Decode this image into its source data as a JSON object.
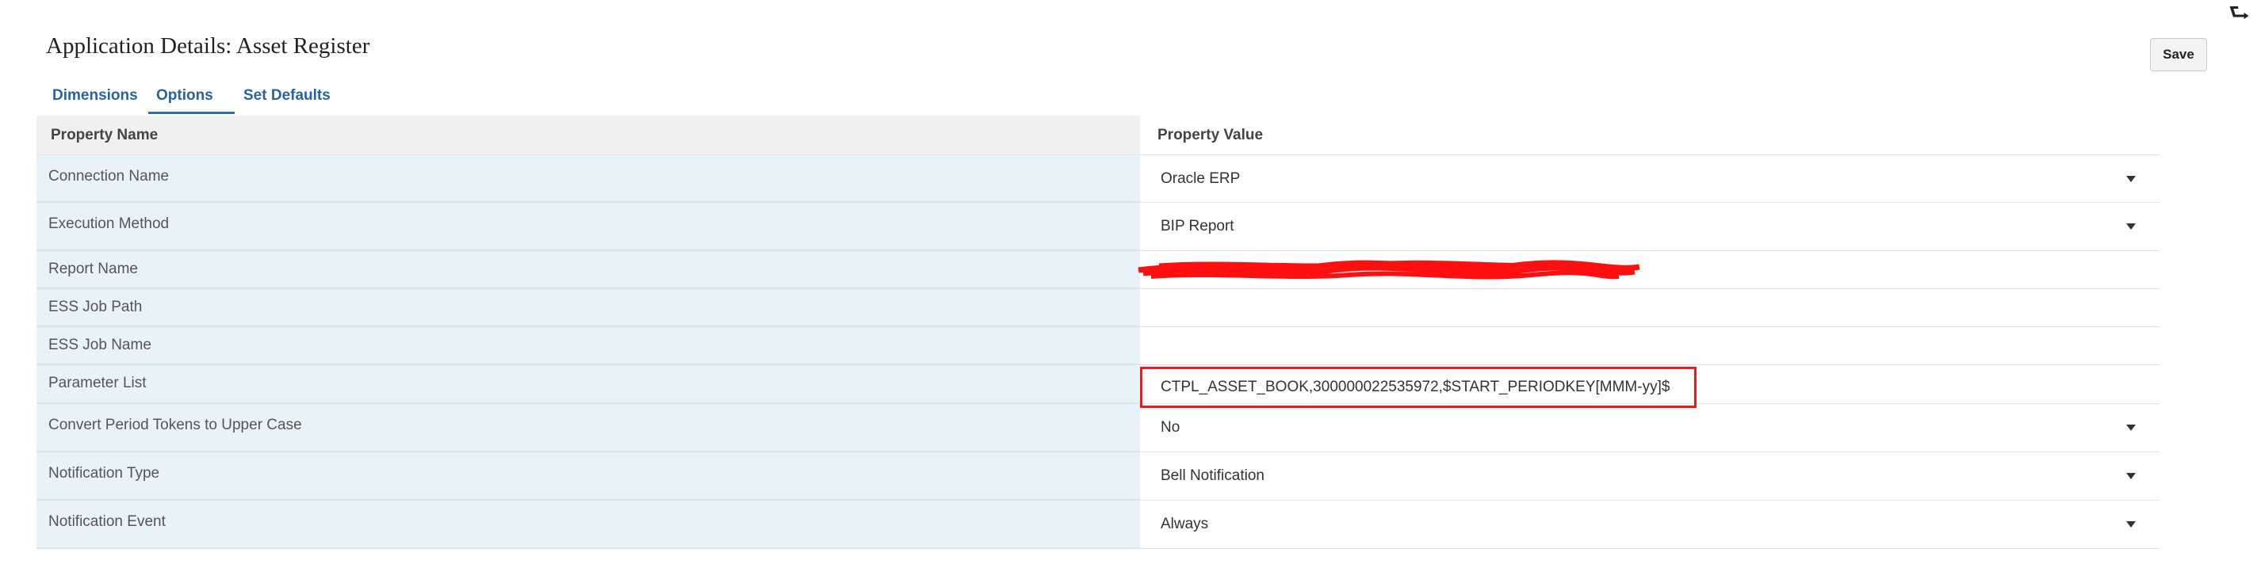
{
  "page": {
    "title": "Application Details: Asset Register",
    "corner_icon": "upload-arrow-icon"
  },
  "toolbar": {
    "save_label": "Save"
  },
  "tabs": [
    {
      "label": "Dimensions",
      "active": false
    },
    {
      "label": "Options",
      "active": true
    },
    {
      "label": "Set Defaults",
      "active": false
    }
  ],
  "table": {
    "headers": {
      "name": "Property Name",
      "value": "Property Value"
    },
    "rows": [
      {
        "name": "Connection Name",
        "value": "Oracle ERP",
        "type": "dropdown"
      },
      {
        "name": "Execution Method",
        "value": "BIP Report",
        "type": "dropdown"
      },
      {
        "name": "Report Name",
        "value": "",
        "type": "redacted"
      },
      {
        "name": "ESS Job Path",
        "value": "",
        "type": "text"
      },
      {
        "name": "ESS Job Name",
        "value": "",
        "type": "text"
      },
      {
        "name": "Parameter List",
        "value": "CTPL_ASSET_BOOK,300000022535972,$START_PERIODKEY[MMM-yy]$",
        "type": "highlighted"
      },
      {
        "name": "Convert Period Tokens to Upper Case",
        "value": "No",
        "type": "dropdown"
      },
      {
        "name": "Notification Type",
        "value": "Bell Notification",
        "type": "dropdown"
      },
      {
        "name": "Notification Event",
        "value": "Always",
        "type": "dropdown"
      }
    ]
  },
  "colors": {
    "accent": "#2a6fb5",
    "link": "#2a6496",
    "name_column_bg": "#e8f2f9",
    "header_bg": "#f0f0f0",
    "highlight": "#e0201c"
  }
}
